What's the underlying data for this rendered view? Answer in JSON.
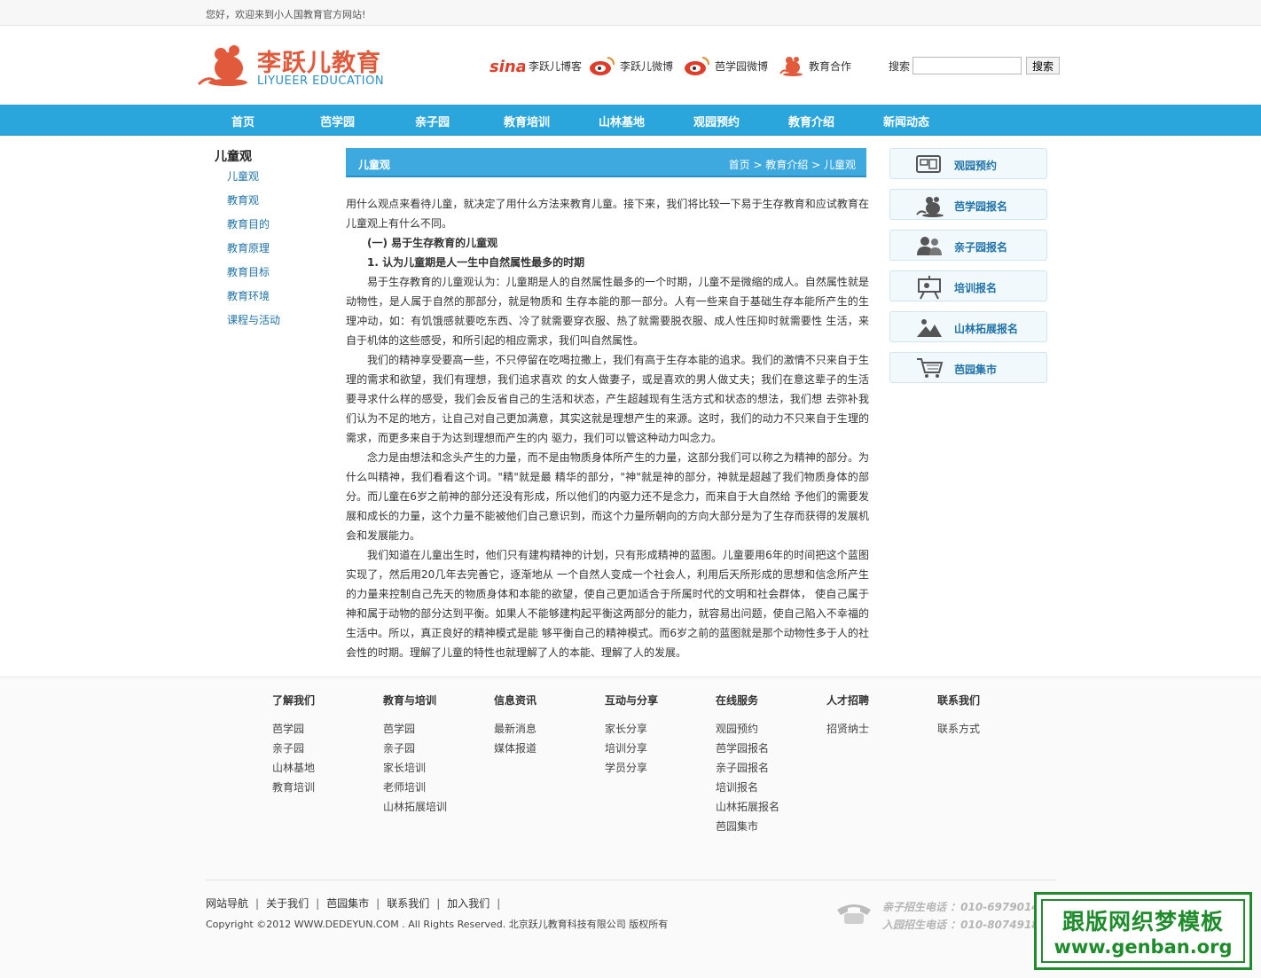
{
  "topbar": {
    "welcome": "您好，欢迎来到小人国教育官方网站!"
  },
  "logo": {
    "cn": "李跃儿教育",
    "en": "LIYUEER EDUCATION"
  },
  "social": [
    "李跃儿博客",
    "李跃儿微博",
    "芭学园微博",
    "教育合作"
  ],
  "search": {
    "label": "搜索",
    "value": "",
    "button": "搜索"
  },
  "nav": [
    "首页",
    "芭学园",
    "亲子园",
    "教育培训",
    "山林基地",
    "观园预约",
    "教育介绍",
    "新闻动态"
  ],
  "sidebar": {
    "title": "儿童观",
    "items": [
      "儿童观",
      "教育观",
      "教育目的",
      "教育原理",
      "教育目标",
      "教育环境",
      "课程与活动"
    ]
  },
  "content": {
    "title": "儿童观",
    "breadcrumb": "首页 > 教育介绍 > 儿童观",
    "p1": "用什么观点来看待儿童，就决定了用什么方法来教育儿童。接下来，我们将比较一下易于生存教育和应试教育在儿童观上有什么不同。",
    "h1": "(一) 易于生存教育的儿童观",
    "h2": "1. 认为儿童期是人一生中自然属性最多的时期",
    "p2": "易于生存教育的儿童观认为：儿童期是人的自然属性最多的一个时期，儿童不是微缩的成人。自然属性就是动物性，是人属于自然的那部分，就是物质和 生存本能的那一部分。人有一些来自于基础生存本能所产生的生理冲动，如：有饥饿感就要吃东西、冷了就需要穿衣服、热了就需要脱衣服、成人性压抑时就需要性 生活，来自于机体的这些感受，和所引起的相应需求，我们叫自然属性。",
    "p3": "我们的精神享受要高一些，不只停留在吃喝拉撒上，我们有高于生存本能的追求。我们的激情不只来自于生理的需求和欲望，我们有理想，我们追求喜欢 的女人做妻子，或是喜欢的男人做丈夫；我们在意这辈子的生活要寻求什么样的感受，我们会反省自己的生活和状态，产生超越现有生活方式和状态的想法，我们想 去弥补我们认为不足的地方，让自己对自己更加满意，其实这就是理想产生的来源。这时，我们的动力不只来自于生理的需求，而更多来自于为达到理想而产生的内 驱力，我们可以管这种动力叫念力。",
    "p4": "念力是由想法和念头产生的力量，而不是由物质身体所产生的力量，这部分我们可以称之为精神的部分。为什么叫精神，我们看看这个词。\"精\"就是最 精华的部分，\"神\"就是神的部分，神就是超越了我们物质身体的部分。而儿童在6岁之前神的部分还没有形成，所以他们的内驱力还不是念力，而来自于大自然给 予他们的需要发展和成长的力量，这个力量不能被他们自己意识到，而这个力量所朝向的方向大部分是为了生存而获得的发展机会和发展能力。",
    "p5": "我们知道在儿童出生时，他们只有建构精神的计划，只有形成精神的蓝图。儿童要用6年的时间把这个蓝图实现了，然后用20几年去完善它，逐渐地从 一个自然人变成一个社会人，利用后天所形成的思想和信念所产生的力量来控制自己先天的物质身体和本能的欲望，使自己更加适合于所属时代的文明和社会群体， 使自己属于神和属于动物的部分达到平衡。如果人不能够建构起平衡这两部分的能力，就容易出问题，使自己陷入不幸福的生活中。所以，真正良好的精神模式是能 够平衡自己的精神模式。而6岁之前的蓝图就是那个动物性多于人的社会性的时期。理解了儿童的特性也就理解了人的本能、理解了人的发展。"
  },
  "right_buttons": [
    {
      "label": "观园预约",
      "icon": "monitor-icon"
    },
    {
      "label": "芭学园报名",
      "icon": "mouse-icon"
    },
    {
      "label": "亲子园报名",
      "icon": "people-icon"
    },
    {
      "label": "培训报名",
      "icon": "presentation-icon"
    },
    {
      "label": "山林拓展报名",
      "icon": "mountain-icon"
    },
    {
      "label": "芭园集市",
      "icon": "cart-icon"
    }
  ],
  "footer": {
    "columns": [
      {
        "title": "了解我们",
        "links": [
          "芭学园",
          "亲子园",
          "山林基地",
          "教育培训"
        ]
      },
      {
        "title": "教育与培训",
        "links": [
          "芭学园",
          "亲子园",
          "家长培训",
          "老师培训",
          "山林拓展培训"
        ]
      },
      {
        "title": "信息资讯",
        "links": [
          "最新消息",
          "媒体报道"
        ]
      },
      {
        "title": "互动与分享",
        "links": [
          "家长分享",
          "培训分享",
          "学员分享"
        ]
      },
      {
        "title": "在线服务",
        "links": [
          "观园预约",
          "芭学园报名",
          "亲子园报名",
          "培训报名",
          "山林拓展报名",
          "芭园集市"
        ]
      },
      {
        "title": "人才招聘",
        "links": [
          "招贤纳士"
        ]
      },
      {
        "title": "联系我们",
        "links": [
          "联系方式"
        ]
      }
    ],
    "bottom_links": [
      "网站导航",
      "关于我们",
      "芭园集市",
      "联系我们",
      "加入我们"
    ],
    "copyright": "Copyright ©2012 WWW.DEDEYUN.COM . All Rights Reserved.    北京跃儿教育科技有限公司 版权所有",
    "phone1": "亲子招生电话 ：010-6979014",
    "phone2": "入园招生电话 ：010-8074918"
  },
  "watermark": {
    "line1": "跟版网织梦模板",
    "line2": "www.genban.org"
  },
  "colors": {
    "nav": "#2aa6dd",
    "logo_red": "#e05a3b",
    "link_blue": "#1f73a8",
    "watermark_green": "#1f8c2c"
  }
}
